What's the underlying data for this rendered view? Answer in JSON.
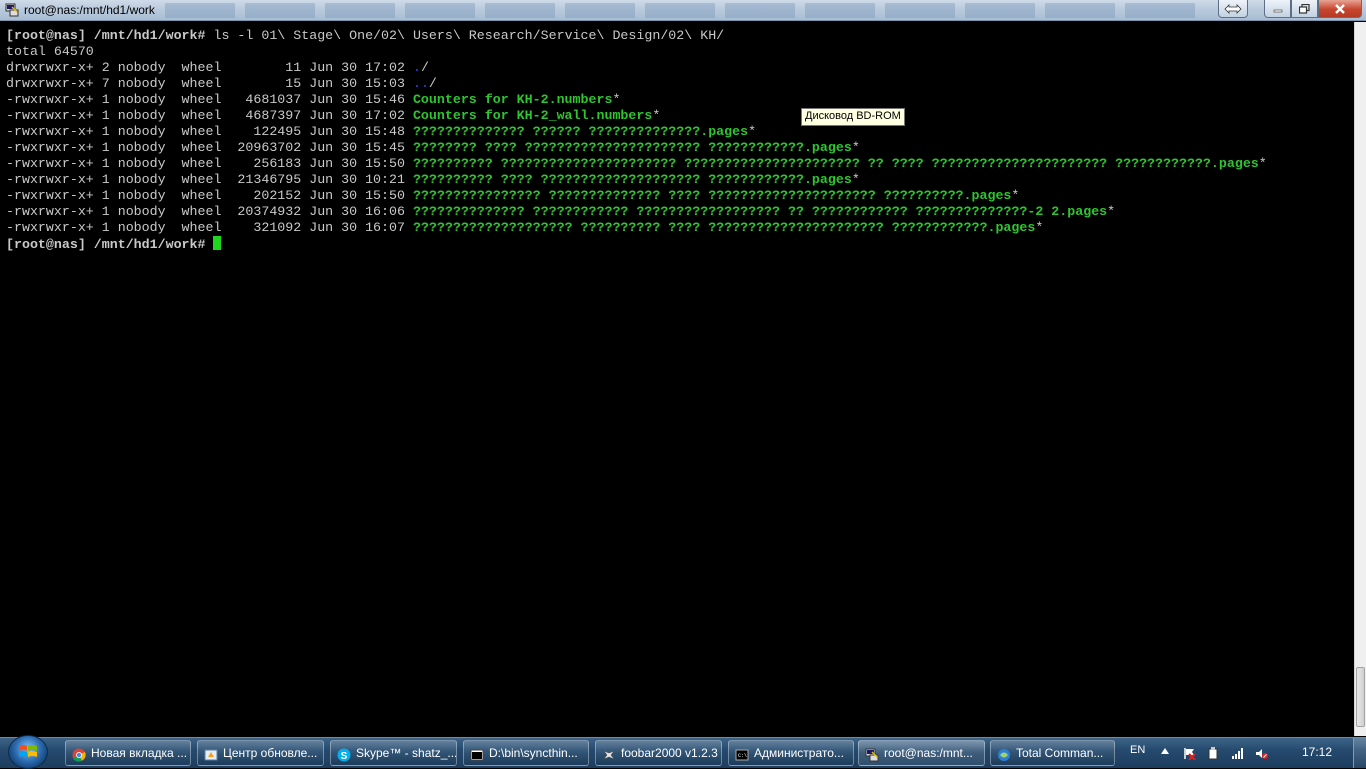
{
  "window": {
    "title": "root@nas:/mnt/hd1/work"
  },
  "terminal": {
    "lines": [
      [
        {
          "t": "[root@nas] /mnt/hd1/work# ",
          "c": "prompt"
        },
        {
          "t": "ls -l 01\\ Stage\\ One/02\\ Users\\ Research/Service\\ Design/02\\ KH/",
          "c": ""
        }
      ],
      [
        {
          "t": "total 64570",
          "c": ""
        }
      ],
      [
        {
          "t": "drwxrwxr-x+ 2 nobody  wheel        11 Jun 30 17:02 ",
          "c": ""
        },
        {
          "t": ".",
          "c": "b"
        },
        {
          "t": "/",
          "c": ""
        }
      ],
      [
        {
          "t": "drwxrwxr-x+ 7 nobody  wheel        15 Jun 30 15:03 ",
          "c": ""
        },
        {
          "t": "..",
          "c": "b"
        },
        {
          "t": "/",
          "c": ""
        }
      ],
      [
        {
          "t": "-rwxrwxr-x+ 1 nobody  wheel   4681037 Jun 30 15:46 ",
          "c": ""
        },
        {
          "t": "Counters for KH-2.numbers",
          "c": "g"
        },
        {
          "t": "*",
          "c": ""
        }
      ],
      [
        {
          "t": "-rwxrwxr-x+ 1 nobody  wheel   4687397 Jun 30 17:02 ",
          "c": ""
        },
        {
          "t": "Counters for KH-2_wall.numbers",
          "c": "g"
        },
        {
          "t": "*",
          "c": ""
        }
      ],
      [
        {
          "t": "-rwxrwxr-x+ 1 nobody  wheel    122495 Jun 30 15:48 ",
          "c": ""
        },
        {
          "t": "?????????????? ?????? ??????????????.pages",
          "c": "g"
        },
        {
          "t": "*",
          "c": ""
        }
      ],
      [
        {
          "t": "-rwxrwxr-x+ 1 nobody  wheel  20963702 Jun 30 15:45 ",
          "c": ""
        },
        {
          "t": "???????? ???? ?????????????????????? ????????????.pages",
          "c": "g"
        },
        {
          "t": "*",
          "c": ""
        }
      ],
      [
        {
          "t": "-rwxrwxr-x+ 1 nobody  wheel    256183 Jun 30 15:50 ",
          "c": ""
        },
        {
          "t": "?????????? ?????????????????????? ?????????????????????? ?? ???? ?????????????????????? ????????????.pages",
          "c": "g"
        },
        {
          "t": "*",
          "c": ""
        }
      ],
      [
        {
          "t": "-rwxrwxr-x+ 1 nobody  wheel  21346795 Jun 30 10:21 ",
          "c": ""
        },
        {
          "t": "?????????? ???? ???????????????????? ????????????.pages",
          "c": "g"
        },
        {
          "t": "*",
          "c": ""
        }
      ],
      [
        {
          "t": "-rwxrwxr-x+ 1 nobody  wheel    202152 Jun 30 15:50 ",
          "c": ""
        },
        {
          "t": "???????????????? ?????????????? ???? ????????????????????? ??????????.pages",
          "c": "g"
        },
        {
          "t": "*",
          "c": ""
        }
      ],
      [
        {
          "t": "-rwxrwxr-x+ 1 nobody  wheel  20374932 Jun 30 16:06 ",
          "c": ""
        },
        {
          "t": "?????????????? ???????????? ?????????????????? ?? ???????????? ??????????????-2 2.pages",
          "c": "g"
        },
        {
          "t": "*",
          "c": ""
        }
      ],
      [
        {
          "t": "-rwxrwxr-x+ 1 nobody  wheel    321092 Jun 30 16:07 ",
          "c": ""
        },
        {
          "t": "???????????????????? ?????????? ???? ?????????????????????? ????????????.pages",
          "c": "g"
        },
        {
          "t": "*",
          "c": ""
        }
      ],
      [
        {
          "t": "[root@nas] /mnt/hd1/work# ",
          "c": "prompt"
        }
      ]
    ],
    "colors": {
      "background": "#000000",
      "text": "#c9c9c9",
      "executable": "#2fc52f",
      "directory": "#2a38c8",
      "cursor": "#1ed81e"
    }
  },
  "tooltip": {
    "text": "Дисковод BD-ROM"
  },
  "taskbar": {
    "items": [
      {
        "label": "Новая вкладка ...",
        "icon": "chrome-icon",
        "active": false
      },
      {
        "label": "Центр обновле...",
        "icon": "windows-update-icon",
        "active": false
      },
      {
        "label": "Skype™ - shatz_...",
        "icon": "skype-icon",
        "active": false
      },
      {
        "label": "D:\\bin\\syncthin...",
        "icon": "console-icon",
        "active": false
      },
      {
        "label": "foobar2000 v1.2.3",
        "icon": "foobar-icon",
        "active": false
      },
      {
        "label": "Администрато...",
        "icon": "cmd-icon",
        "active": false
      },
      {
        "label": "root@nas:/mnt...",
        "icon": "putty-icon",
        "active": true
      },
      {
        "label": "Total Comman...",
        "icon": "total-commander-icon",
        "active": false
      }
    ],
    "language": "EN",
    "clock": "17:12"
  }
}
